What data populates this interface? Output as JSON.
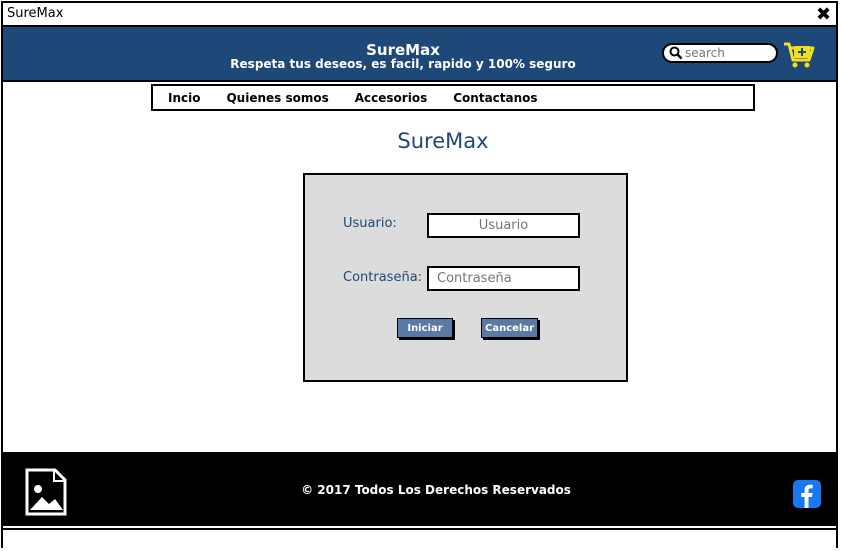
{
  "window": {
    "title": "SureMax",
    "close_symbol": "✖"
  },
  "header": {
    "brand": "SureMax",
    "tagline": "Respeta tus deseos, es facil, rapido y 100% seguro",
    "search_placeholder": "search",
    "search_icon": "search-icon",
    "cart_icon": "cart-add-icon",
    "colors": {
      "background": "#1e4878",
      "cart": "#f2e01b"
    }
  },
  "nav": {
    "items": [
      {
        "label": "Incio"
      },
      {
        "label": "Quienes somos"
      },
      {
        "label": "Accesorios"
      },
      {
        "label": "Contactanos"
      }
    ]
  },
  "main": {
    "title": "SureMax",
    "login": {
      "username_label": "Usuario:",
      "username_placeholder": "Usuario",
      "password_label": "Contraseña:",
      "password_placeholder": "Contraseña",
      "submit_label": "Iniciar",
      "cancel_label": "Cancelar"
    }
  },
  "footer": {
    "copyright": "© 2017 Todos Los Derechos Reservados",
    "image_icon": "image-icon",
    "social_icon": "facebook-icon",
    "colors": {
      "background": "#000000",
      "facebook": "#1877f2"
    }
  }
}
